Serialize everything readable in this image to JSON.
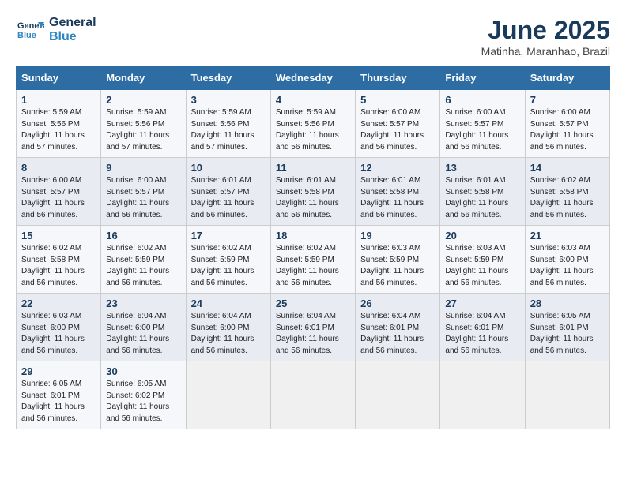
{
  "header": {
    "logo_line1": "General",
    "logo_line2": "Blue",
    "month": "June 2025",
    "location": "Matinha, Maranhao, Brazil"
  },
  "weekdays": [
    "Sunday",
    "Monday",
    "Tuesday",
    "Wednesday",
    "Thursday",
    "Friday",
    "Saturday"
  ],
  "weeks": [
    [
      {
        "day": "1",
        "sunrise": "5:59 AM",
        "sunset": "5:56 PM",
        "daylight": "11 hours and 57 minutes."
      },
      {
        "day": "2",
        "sunrise": "5:59 AM",
        "sunset": "5:56 PM",
        "daylight": "11 hours and 57 minutes."
      },
      {
        "day": "3",
        "sunrise": "5:59 AM",
        "sunset": "5:56 PM",
        "daylight": "11 hours and 57 minutes."
      },
      {
        "day": "4",
        "sunrise": "5:59 AM",
        "sunset": "5:56 PM",
        "daylight": "11 hours and 56 minutes."
      },
      {
        "day": "5",
        "sunrise": "6:00 AM",
        "sunset": "5:57 PM",
        "daylight": "11 hours and 56 minutes."
      },
      {
        "day": "6",
        "sunrise": "6:00 AM",
        "sunset": "5:57 PM",
        "daylight": "11 hours and 56 minutes."
      },
      {
        "day": "7",
        "sunrise": "6:00 AM",
        "sunset": "5:57 PM",
        "daylight": "11 hours and 56 minutes."
      }
    ],
    [
      {
        "day": "8",
        "sunrise": "6:00 AM",
        "sunset": "5:57 PM",
        "daylight": "11 hours and 56 minutes."
      },
      {
        "day": "9",
        "sunrise": "6:00 AM",
        "sunset": "5:57 PM",
        "daylight": "11 hours and 56 minutes."
      },
      {
        "day": "10",
        "sunrise": "6:01 AM",
        "sunset": "5:57 PM",
        "daylight": "11 hours and 56 minutes."
      },
      {
        "day": "11",
        "sunrise": "6:01 AM",
        "sunset": "5:58 PM",
        "daylight": "11 hours and 56 minutes."
      },
      {
        "day": "12",
        "sunrise": "6:01 AM",
        "sunset": "5:58 PM",
        "daylight": "11 hours and 56 minutes."
      },
      {
        "day": "13",
        "sunrise": "6:01 AM",
        "sunset": "5:58 PM",
        "daylight": "11 hours and 56 minutes."
      },
      {
        "day": "14",
        "sunrise": "6:02 AM",
        "sunset": "5:58 PM",
        "daylight": "11 hours and 56 minutes."
      }
    ],
    [
      {
        "day": "15",
        "sunrise": "6:02 AM",
        "sunset": "5:58 PM",
        "daylight": "11 hours and 56 minutes."
      },
      {
        "day": "16",
        "sunrise": "6:02 AM",
        "sunset": "5:59 PM",
        "daylight": "11 hours and 56 minutes."
      },
      {
        "day": "17",
        "sunrise": "6:02 AM",
        "sunset": "5:59 PM",
        "daylight": "11 hours and 56 minutes."
      },
      {
        "day": "18",
        "sunrise": "6:02 AM",
        "sunset": "5:59 PM",
        "daylight": "11 hours and 56 minutes."
      },
      {
        "day": "19",
        "sunrise": "6:03 AM",
        "sunset": "5:59 PM",
        "daylight": "11 hours and 56 minutes."
      },
      {
        "day": "20",
        "sunrise": "6:03 AM",
        "sunset": "5:59 PM",
        "daylight": "11 hours and 56 minutes."
      },
      {
        "day": "21",
        "sunrise": "6:03 AM",
        "sunset": "6:00 PM",
        "daylight": "11 hours and 56 minutes."
      }
    ],
    [
      {
        "day": "22",
        "sunrise": "6:03 AM",
        "sunset": "6:00 PM",
        "daylight": "11 hours and 56 minutes."
      },
      {
        "day": "23",
        "sunrise": "6:04 AM",
        "sunset": "6:00 PM",
        "daylight": "11 hours and 56 minutes."
      },
      {
        "day": "24",
        "sunrise": "6:04 AM",
        "sunset": "6:00 PM",
        "daylight": "11 hours and 56 minutes."
      },
      {
        "day": "25",
        "sunrise": "6:04 AM",
        "sunset": "6:01 PM",
        "daylight": "11 hours and 56 minutes."
      },
      {
        "day": "26",
        "sunrise": "6:04 AM",
        "sunset": "6:01 PM",
        "daylight": "11 hours and 56 minutes."
      },
      {
        "day": "27",
        "sunrise": "6:04 AM",
        "sunset": "6:01 PM",
        "daylight": "11 hours and 56 minutes."
      },
      {
        "day": "28",
        "sunrise": "6:05 AM",
        "sunset": "6:01 PM",
        "daylight": "11 hours and 56 minutes."
      }
    ],
    [
      {
        "day": "29",
        "sunrise": "6:05 AM",
        "sunset": "6:01 PM",
        "daylight": "11 hours and 56 minutes."
      },
      {
        "day": "30",
        "sunrise": "6:05 AM",
        "sunset": "6:02 PM",
        "daylight": "11 hours and 56 minutes."
      },
      null,
      null,
      null,
      null,
      null
    ]
  ]
}
